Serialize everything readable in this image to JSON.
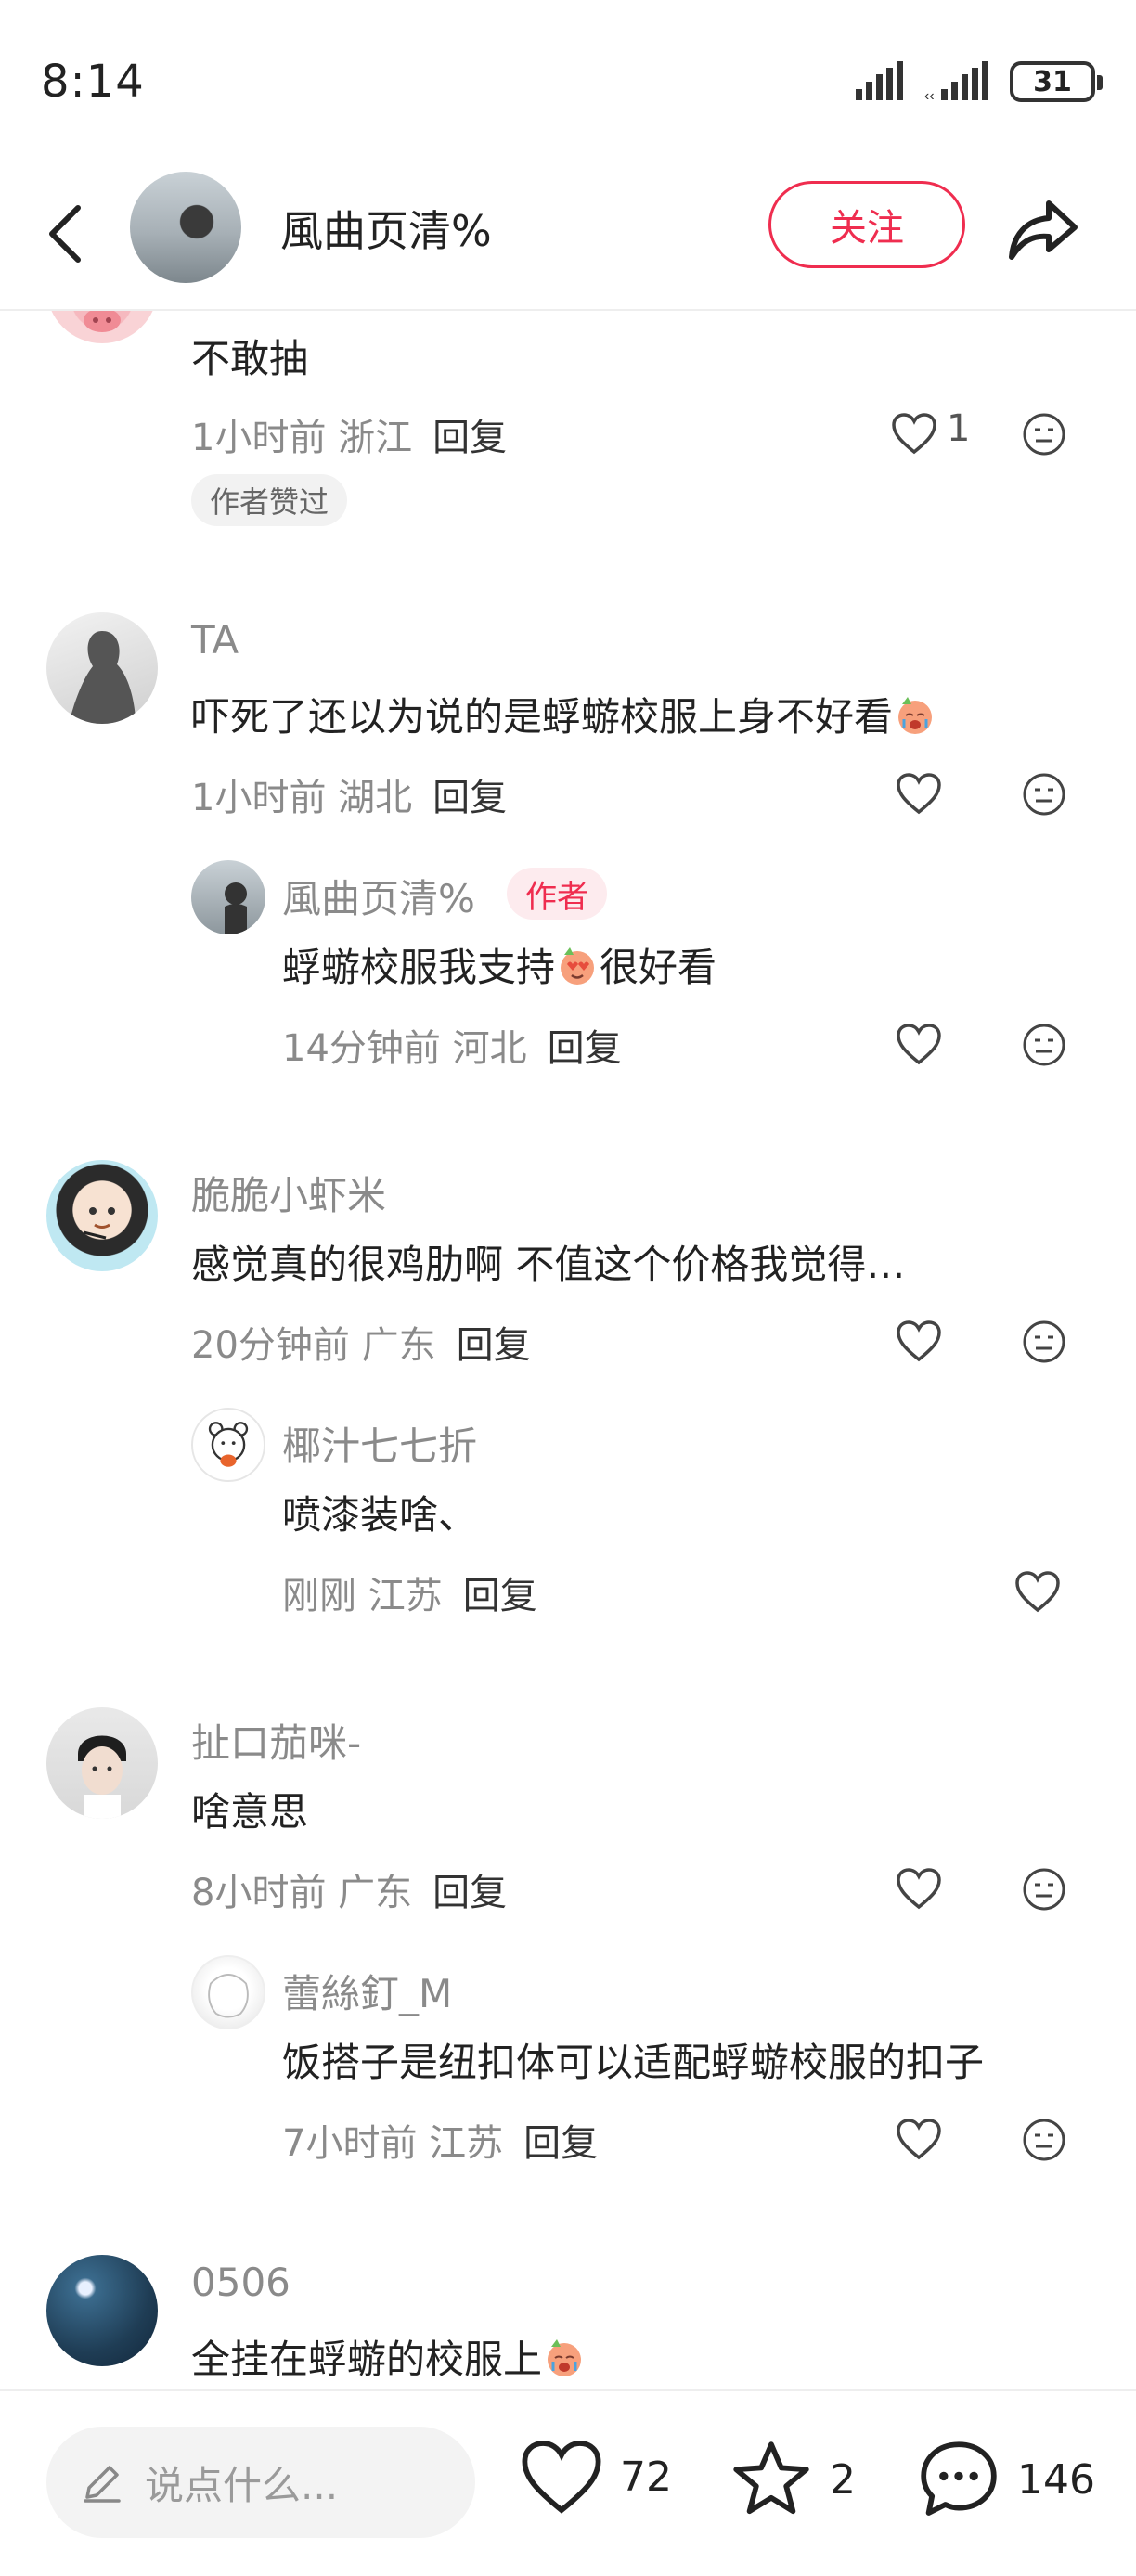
{
  "status_bar": {
    "time": "8:14",
    "battery": "31"
  },
  "header": {
    "author_name": "風曲页清%",
    "follow_label": "关注"
  },
  "comments": [
    {
      "text": "不敢抽",
      "meta": "1小时前 浙江",
      "reply": "回复",
      "likes": "1",
      "badge": "作者赞过"
    },
    {
      "name": "TA",
      "text": "吓死了还以为说的是蜉蝣校服上身不好看",
      "meta": "1小时前 湖北",
      "reply": "回复",
      "sub": {
        "name": "風曲页清%",
        "badge": "作者",
        "text_a": "蜉蝣校服我支持",
        "text_b": "很好看",
        "meta": "14分钟前 河北",
        "reply": "回复"
      }
    },
    {
      "name": "脆脆小虾米",
      "text": "感觉真的很鸡肋啊 不值这个价格我觉得…",
      "meta": "20分钟前 广东",
      "reply": "回复",
      "sub": {
        "name": "椰汁七七折",
        "text": "喷漆装啥、",
        "meta": "刚刚 江苏",
        "reply": "回复"
      }
    },
    {
      "name": "扯口茄咪-",
      "text": "啥意思",
      "meta": "8小时前 广东",
      "reply": "回复",
      "sub": {
        "name": "蕾絲釘_M",
        "text": "饭搭子是纽扣体可以适配蜉蝣校服的扣子",
        "meta": "7小时前 江苏",
        "reply": "回复"
      }
    },
    {
      "name": "0506",
      "text": "全挂在蜉蝣的校服上"
    }
  ],
  "bottom_bar": {
    "input_placeholder": "说点什么...",
    "likes": "72",
    "favorites": "2",
    "comments": "146"
  },
  "colors": {
    "accent": "#ef2d4f",
    "meta": "#8a8a8a"
  }
}
